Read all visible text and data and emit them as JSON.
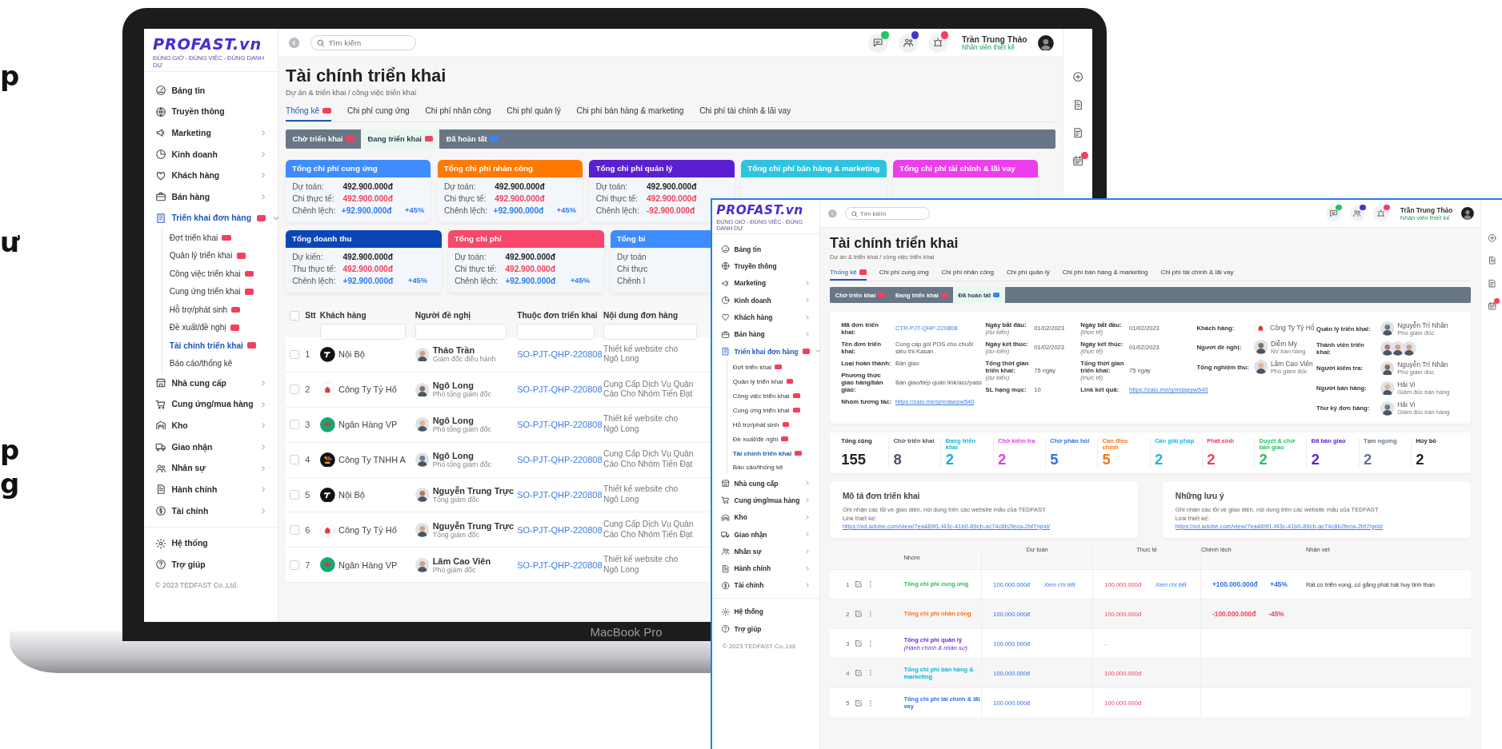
{
  "promo_fragments": [
    "p",
    "ư",
    "p",
    "g"
  ],
  "laptop": {
    "model_label": "MacBook Pro",
    "screen": {
      "logo": {
        "brand": "PROFAST.vn",
        "tagline": "ĐÚNG GIỜ - ĐÚNG VIỆC - ĐÚNG DANH DỰ"
      },
      "sidebar": {
        "items": [
          {
            "label": "Bảng tin",
            "selected": false
          },
          {
            "label": "Truyền thông",
            "selected": false
          },
          {
            "label": "Marketing",
            "selected": false,
            "expanded": false
          },
          {
            "label": "Kinh doanh",
            "selected": false,
            "expanded": false
          },
          {
            "label": "Khách hàng",
            "selected": false,
            "expanded": false
          },
          {
            "label": "Bán hàng",
            "selected": false,
            "expanded": false
          },
          {
            "label": "Triển khai đơn hàng",
            "selected": true,
            "expanded": true,
            "badge": true,
            "children": [
              {
                "label": "Đợt triển khai",
                "selected": false,
                "badge": true
              },
              {
                "label": "Quản lý triển khai",
                "selected": false,
                "badge": true
              },
              {
                "label": "Công việc triển khai",
                "selected": false,
                "badge": true
              },
              {
                "label": "Cung ứng triển khai",
                "selected": false,
                "badge": true
              },
              {
                "label": "Hỗ trợ/phát sinh",
                "selected": false,
                "badge": true
              },
              {
                "label": "Đề xuất/đề nghị",
                "selected": false,
                "badge": true
              },
              {
                "label": "Tài chính triển khai",
                "selected": true,
                "badge": true
              },
              {
                "label": "Báo cáo/thống kê",
                "selected": false
              }
            ]
          },
          {
            "label": "Nhà cung cấp",
            "selected": false,
            "expanded": false
          },
          {
            "label": "Cung ứng/mua hàng",
            "selected": false,
            "expanded": false
          },
          {
            "label": "Kho",
            "selected": false,
            "expanded": false
          },
          {
            "label": "Giao nhận",
            "selected": false,
            "expanded": false
          },
          {
            "label": "Nhân sự",
            "selected": false,
            "expanded": false
          },
          {
            "label": "Hành chính",
            "selected": false,
            "expanded": false
          },
          {
            "label": "Tài chính",
            "selected": false,
            "expanded": false
          }
        ],
        "bottom_items": [
          {
            "label": "Hệ thống",
            "selected": false
          },
          {
            "label": "Trợ giúp",
            "selected": false
          }
        ],
        "footer": "© 2023 TEDFAST Co.,Ltd."
      },
      "search": {
        "placeholder": "Tìm kiếm"
      },
      "notifications": [
        {
          "color": "#22c55e"
        },
        {
          "color": "#4338ca"
        },
        {
          "color": "#f43f5e"
        }
      ],
      "user": {
        "name": "Trần Trung Thảo",
        "role": "Nhân viên thiết kế"
      },
      "title": "Tài chính triển khai",
      "breadcrumb": "Dự án & triển khai / công việc triển khai",
      "tabs": [
        {
          "label": "Thống kê",
          "selected": true,
          "badge": true
        },
        {
          "label": "Chi phí cung ứng",
          "selected": false
        },
        {
          "label": "Chi phí nhân công",
          "selected": false
        },
        {
          "label": "Chi phí quản lý",
          "selected": false
        },
        {
          "label": "Chi phí bán hàng & marketing",
          "selected": false
        },
        {
          "label": "Chi phí tài chính & lãi vay",
          "selected": false
        }
      ],
      "status_tabs": [
        {
          "label": "Chờ triển khai",
          "selected": false,
          "color": "#f43f5e"
        },
        {
          "label": "Đang triển khai",
          "selected": true,
          "color": "#f43f5e"
        },
        {
          "label": "Đã hoàn tất",
          "selected": false,
          "color": "#3b82f6"
        }
      ],
      "card_rows": [
        {
          "cards": [
            {
              "title": "Tổng chi phí cung ứng",
              "color": "#3f8cff",
              "rows": [
                {
                  "label": "Dự toán:",
                  "value": "492.900.000đ",
                  "color": "#222222"
                },
                {
                  "label": "Chi thực tế:",
                  "value": "492.900.000đ",
                  "color": "#f0435a"
                },
                {
                  "label": "Chênh lệch:",
                  "value": "+92.900.000đ",
                  "color": "#2f7bf0",
                  "percent": "+45%"
                }
              ]
            },
            {
              "title": "Tổng chi phí nhân công",
              "color": "#ff7a00",
              "rows": [
                {
                  "label": "Dự toán:",
                  "value": "492.900.000đ",
                  "color": "#222222"
                },
                {
                  "label": "Chi thực tế:",
                  "value": "492.900.000đ",
                  "color": "#f0435a"
                },
                {
                  "label": "Chênh lệch:",
                  "value": "+92.900.000đ",
                  "color": "#2f7bf0",
                  "percent": "+45%"
                }
              ]
            },
            {
              "title": "Tổng chi phí quản lý",
              "color": "#5b1fd1",
              "rows": [
                {
                  "label": "Dự toán:",
                  "value": "492.900.000đ",
                  "color": "#222222"
                },
                {
                  "label": "Chi thực tế:",
                  "value": "492.900.000đ",
                  "color": "#f0435a"
                },
                {
                  "label": "Chênh lệch:",
                  "value": "-92.900.000đ",
                  "color": "#f0435a"
                }
              ]
            },
            {
              "title": "Tổng chi phí bán hàng & marketing",
              "color": "#2ec4df"
            },
            {
              "title": "Tổng chi phí tài chính & lãi vay",
              "color": "#ee3ded"
            }
          ]
        },
        {
          "cards": [
            {
              "title": "Tổng doanh thu",
              "color": "#0a46b5",
              "rows": [
                {
                  "label": "Dự kiến:",
                  "value": "492.900.000đ",
                  "color": "#222222"
                },
                {
                  "label": "Thu thực tế:",
                  "value": "492.900.000đ",
                  "color": "#f0435a"
                },
                {
                  "label": "Chênh lệch:",
                  "value": "+92.900.000đ",
                  "color": "#2f7bf0",
                  "percent": "+45%"
                }
              ]
            },
            {
              "title": "Tổng chi phí",
              "color": "#f7476a",
              "rows": [
                {
                  "label": "Dự toán:",
                  "value": "492.900.000đ",
                  "color": "#222222"
                },
                {
                  "label": "Chi thực tế:",
                  "value": "492.900.000đ",
                  "color": "#f0435a"
                },
                {
                  "label": "Chênh lệch:",
                  "value": "+92.900.000đ",
                  "color": "#2f7bf0",
                  "percent": "+45%"
                }
              ]
            },
            {
              "title": "Tổng bi",
              "color": "#3f8cff",
              "rows": [
                {
                  "label": "Dự toán"
                },
                {
                  "label": "Chi thực"
                },
                {
                  "label": "Chênh l"
                }
              ]
            }
          ]
        }
      ],
      "table": {
        "select_all": {
          "checked": false
        },
        "columns": [
          "Stt",
          "Khách hàng",
          "Người đề nghị",
          "Thuộc đơn triển khai",
          "Nội dung đơn hàng"
        ],
        "rows": [
          {
            "checked": false,
            "stt": "1",
            "customer": "Nội Bộ",
            "logo": {
              "kind": "dark-mark"
            },
            "person": "Thảo Trần",
            "role": "Giám đốc điều hành",
            "order": "SO-PJT-QHP-220808",
            "content": [
              "Thiết kế website cho",
              "Ngô Long"
            ]
          },
          {
            "checked": false,
            "stt": "2",
            "customer": "Công Ty Tỷ Hổ",
            "logo": {
              "kind": "red-mark"
            },
            "person": "Ngô Long",
            "role": "Phó tổng giám đốc",
            "order": "SO-PJT-QHP-220808",
            "content": [
              "Cung Cấp Dịch Vụ Quản",
              "Cáo Cho Nhóm Tiến Đạt"
            ]
          },
          {
            "checked": false,
            "stt": "3",
            "customer": "Ngân Hàng VP",
            "logo": {
              "kind": "flower"
            },
            "person": "Ngô Long",
            "role": "Phó tổng giám đốc",
            "order": "SO-PJT-QHP-220808",
            "content": [
              "Thiết kế website cho",
              "Ngô Long"
            ]
          },
          {
            "checked": false,
            "stt": "4",
            "customer": "Công Ty TNHH A",
            "logo": {
              "kind": "fan"
            },
            "person": "Ngô Long",
            "role": "Phó tổng giám đốc",
            "order": "SO-PJT-QHP-220808",
            "content": [
              "Cung Cấp Dịch Vụ Quản",
              "Cáo Cho Nhóm Tiến Đạt"
            ]
          },
          {
            "checked": false,
            "stt": "5",
            "customer": "Nội Bộ",
            "logo": {
              "kind": "dark-mark"
            },
            "person": "Nguyễn Trung Trực",
            "role": "Tổng giám đốc",
            "order": "SO-PJT-QHP-220808",
            "content": [
              "Thiết kế website cho",
              "Ngô Long"
            ]
          },
          {
            "checked": false,
            "stt": "6",
            "customer": "Công Ty Tỷ Hổ",
            "logo": {
              "kind": "red-mark"
            },
            "person": "Nguyễn Trung Trực",
            "role": "Tổng giám đốc",
            "order": "SO-PJT-QHP-220808",
            "content": [
              "Cung Cấp Dịch Vụ Quản",
              "Cáo Cho Nhóm Tiến Đạt"
            ]
          },
          {
            "checked": false,
            "stt": "7",
            "customer": "Ngân Hàng VP",
            "logo": {
              "kind": "flower"
            },
            "person": "Lâm Cao Viên",
            "role": "Phó giám đốc",
            "order": "SO-PJT-QHP-220808",
            "content": [
              "Thiết kế website cho",
              "Ngô Long"
            ]
          }
        ]
      }
    }
  },
  "front_window": {
    "logo": {
      "brand": "PROFAST.vn",
      "tagline": "ĐÚNG GIỜ - ĐÚNG VIỆC - ĐÚNG DANH DỰ"
    },
    "sidebar": {
      "items": [
        {
          "label": "Bảng tin",
          "selected": false
        },
        {
          "label": "Truyền thông",
          "selected": false
        },
        {
          "label": "Marketing",
          "selected": false,
          "expanded": false
        },
        {
          "label": "Kinh doanh",
          "selected": false,
          "expanded": false
        },
        {
          "label": "Khách hàng",
          "selected": false,
          "expanded": false
        },
        {
          "label": "Bán hàng",
          "selected": false,
          "expanded": false
        },
        {
          "label": "Triển khai đơn hàng",
          "selected": true,
          "expanded": true,
          "badge": true,
          "children": [
            {
              "label": "Đợt triển khai",
              "selected": false,
              "badge": true
            },
            {
              "label": "Quản lý triển khai",
              "selected": false,
              "badge": true
            },
            {
              "label": "Công việc triển khai",
              "selected": false,
              "badge": true
            },
            {
              "label": "Cung ứng triển khai",
              "selected": false,
              "badge": true
            },
            {
              "label": "Hỗ trợ/phát sinh",
              "selected": false,
              "badge": true
            },
            {
              "label": "Đề xuất/đề nghị",
              "selected": false,
              "badge": true
            },
            {
              "label": "Tài chính triển khai",
              "selected": true,
              "badge": true
            },
            {
              "label": "Báo cáo/thống kê",
              "selected": false
            }
          ]
        },
        {
          "label": "Nhà cung cấp",
          "selected": false,
          "expanded": false
        },
        {
          "label": "Cung ứng/mua hàng",
          "selected": false,
          "expanded": false
        },
        {
          "label": "Kho",
          "selected": false,
          "expanded": false
        },
        {
          "label": "Giao nhận",
          "selected": false,
          "expanded": false
        },
        {
          "label": "Nhân sự",
          "selected": false,
          "expanded": false
        },
        {
          "label": "Hành chính",
          "selected": false,
          "expanded": false
        },
        {
          "label": "Tài chính",
          "selected": false,
          "expanded": false
        }
      ],
      "bottom_items": [
        {
          "label": "Hệ thống",
          "selected": false
        },
        {
          "label": "Trợ giúp",
          "selected": false
        }
      ],
      "footer": "© 2023 TEDFAST Co.,Ltd."
    },
    "search": {
      "placeholder": "Tìm kiếm"
    },
    "notifications": [
      {
        "color": "#22c55e"
      },
      {
        "color": "#4338ca"
      },
      {
        "color": "#f43f5e"
      }
    ],
    "user": {
      "name": "Trần Trung Thảo",
      "role": "Nhân viên thiết kế"
    },
    "title": "Tài chính triển khai",
    "breadcrumb": "Dự án & triển khai / công việc triển khai",
    "tabs": [
      {
        "label": "Thống kê",
        "selected": true,
        "badge": true
      },
      {
        "label": "Chi phí cung ứng",
        "selected": false
      },
      {
        "label": "Chi phí nhân công",
        "selected": false
      },
      {
        "label": "Chi phí quản lý",
        "selected": false
      },
      {
        "label": "Chi phí bán hàng & marketing",
        "selected": false
      },
      {
        "label": "Chi phí tài chính & lãi vay",
        "selected": false
      }
    ],
    "status_tabs": [
      {
        "label": "Chờ triển khai",
        "selected": false,
        "color": "#f43f5e"
      },
      {
        "label": "Đang triển khai",
        "selected": false,
        "color": "#f43f5e"
      },
      {
        "label": "Đã hoàn tất",
        "selected": true,
        "color": "#3b82f6"
      }
    ],
    "info_columns": [
      [
        {
          "label": "Mã đơn triển khai:",
          "kind": "code",
          "value": "CTR-PJT-QHP-220808"
        },
        {
          "label": "Tên đơn triển khai:",
          "kind": "text",
          "value": "Cung cấp gói POS cho chuỗi siêu thị Kasan"
        },
        {
          "label": "Loại hoàn thành:",
          "kind": "text",
          "value": "Bàn giao"
        },
        {
          "label": "Phương thức giao hàng/bàn giao:",
          "kind": "text",
          "value": "Bàn giao/tiếp quản link/acc/pass"
        },
        {
          "label": "Nhóm tương tác:",
          "kind": "link",
          "value": "https://zalo.me/g/mdaepw540"
        }
      ],
      [
        {
          "label": "Ngày bắt đầu:",
          "note": "(dự kiến)",
          "kind": "text",
          "value": "01/02/2023"
        },
        {
          "label": "Ngày kết thúc:",
          "note": "(dự kiến)",
          "kind": "text",
          "value": "01/02/2023"
        },
        {
          "label": "Tổng thời gian triển khai:",
          "note": "(dự kiến)",
          "kind": "text",
          "value": "75 ngày"
        },
        {
          "label": "SL hạng mục:",
          "kind": "text",
          "value": "10"
        }
      ],
      [
        {
          "label": "Ngày bắt đầu:",
          "note": "(thực tế)",
          "kind": "text",
          "value": "01/02/2023"
        },
        {
          "label": "Ngày kết thúc:",
          "note": "(thực tế)",
          "kind": "text",
          "value": "01/02/2023"
        },
        {
          "label": "Tổng thời gian triển khai:",
          "note": "(thực tế)",
          "kind": "text",
          "value": "75 ngày"
        },
        {
          "label": "Link kết quả:",
          "kind": "link",
          "value": "https://zalo.me/g/mdaepw540"
        }
      ],
      [
        {
          "label": "Khách hàng:",
          "kind": "company",
          "value": "Công Ty Tỷ Hổ",
          "logo": {
            "kind": "red-mark"
          }
        },
        {
          "label": "Người đề nghị:",
          "kind": "person",
          "value": "Diễm My",
          "role": "NV bán hàng"
        },
        {
          "label": "Tổng nghiệm thu:",
          "kind": "person",
          "value": "Lâm Cao Viên",
          "role": "Phó giám đốc"
        }
      ],
      [
        {
          "label": "Quản lý triển khai:",
          "kind": "person",
          "value": "Nguyễn Trí Nhân",
          "role": "Phó giám đốc"
        },
        {
          "label": "Thành viên triển khai:",
          "kind": "members"
        },
        {
          "label": "Người kiểm tra:",
          "kind": "person",
          "value": "Nguyễn Trí Nhân",
          "role": "Phó giám đốc"
        },
        {
          "label": "Người bán hàng:",
          "kind": "person",
          "value": "Hải Vi",
          "role": "Giám đốc bán hàng"
        },
        {
          "label": "Thư ký đơn hàng:",
          "kind": "person",
          "value": "Hải Vi",
          "role": "Giám đốc bán hàng"
        }
      ]
    ],
    "stats": [
      {
        "label": "Tổng cộng",
        "value": "155",
        "color": "#1f2328"
      },
      {
        "label": "Chờ triển khai",
        "value": "8",
        "color": "#4b5563"
      },
      {
        "label": "Đang triển khai",
        "value": "2",
        "color": "#12b3d6"
      },
      {
        "label": "Chờ kiểm tra",
        "value": "2",
        "color": "#e33fe6"
      },
      {
        "label": "Chờ phản hồi",
        "value": "5",
        "color": "#2f6fe8"
      },
      {
        "label": "Cần điều chỉnh",
        "value": "5",
        "color": "#f97316"
      },
      {
        "label": "Cần giải pháp",
        "value": "2",
        "color": "#1fb7d4"
      },
      {
        "label": "Phát sinh",
        "value": "2",
        "color": "#ef3b5a"
      },
      {
        "label": "Duyệt & chờ bàn giao",
        "value": "2",
        "color": "#22c55e"
      },
      {
        "label": "Đã bàn giao",
        "value": "2",
        "color": "#5b21d6"
      },
      {
        "label": "Tạm ngưng",
        "value": "2",
        "color": "#64748b"
      },
      {
        "label": "Hủy bỏ",
        "value": "2",
        "color": "#1f2328"
      }
    ],
    "notes": [
      {
        "title": "Mô tả đơn triển khai",
        "text": "Ghi nhận các lỗi về giao diện, nội dung trên các website mẫu của TEDFAST",
        "link_label": "Link thiết kế:",
        "link": "https://xd.adobe.com/view/7ea489f1-f43c-41b0-89cb-ac74c8b2feca-2bf7/grid/"
      },
      {
        "title": "Những lưu ý",
        "text": "Ghi nhận các lỗi về giao diện, nội dung trên các website mẫu của TEDFAST",
        "link_label": "Link thiết kế:",
        "link": "https://xd.adobe.com/view/7ea489f1-f43c-41b0-89cb-ac74c8b2feca-2bf7/grid/"
      }
    ],
    "cost_table": {
      "columns": [
        "Nhóm",
        "Dự toán",
        "Thực tế",
        "Chênh lệch",
        "Nhận xét"
      ],
      "rows": [
        {
          "index": "1",
          "group": "Tổng chi phí cung ứng",
          "color": "#22c55e",
          "budget": "100.000.000đ",
          "budget_link": "Xem chi tiết",
          "actual": "100.000.000đ",
          "actual_link": "Xem chi tiết",
          "diff": {
            "text": "+100.000.000đ",
            "percent": "+45%",
            "color": "#2f6fe8"
          },
          "comment": "Rất có triển vọng, cố gắng phát hát huy tinh thần"
        },
        {
          "index": "2",
          "group": "Tổng chi phí nhân công",
          "color": "#f97316",
          "budget": "100.000.000đ",
          "actual": "100.000.000đ",
          "diff": {
            "text": "-100.000.000đ",
            "percent": "-45%",
            "color": "#f0435a"
          }
        },
        {
          "index": "3",
          "group": "Tổng chi phí quản lý",
          "group_note": "(Hành chính & nhân sự)",
          "color": "#6d28d9",
          "budget": "100.000.000đ",
          "actual": "-"
        },
        {
          "index": "4",
          "group": "Tổng chi phí bán hàng & marketing",
          "color": "#12b3d6",
          "budget": "100.000.000đ",
          "actual": "100.000.000đ"
        },
        {
          "index": "5",
          "group": "Tổng chi phí tài chính & lãi vay",
          "color": "#2f6fe8",
          "budget": "100.000.000đ",
          "actual": "100.000.000đ"
        }
      ]
    }
  }
}
